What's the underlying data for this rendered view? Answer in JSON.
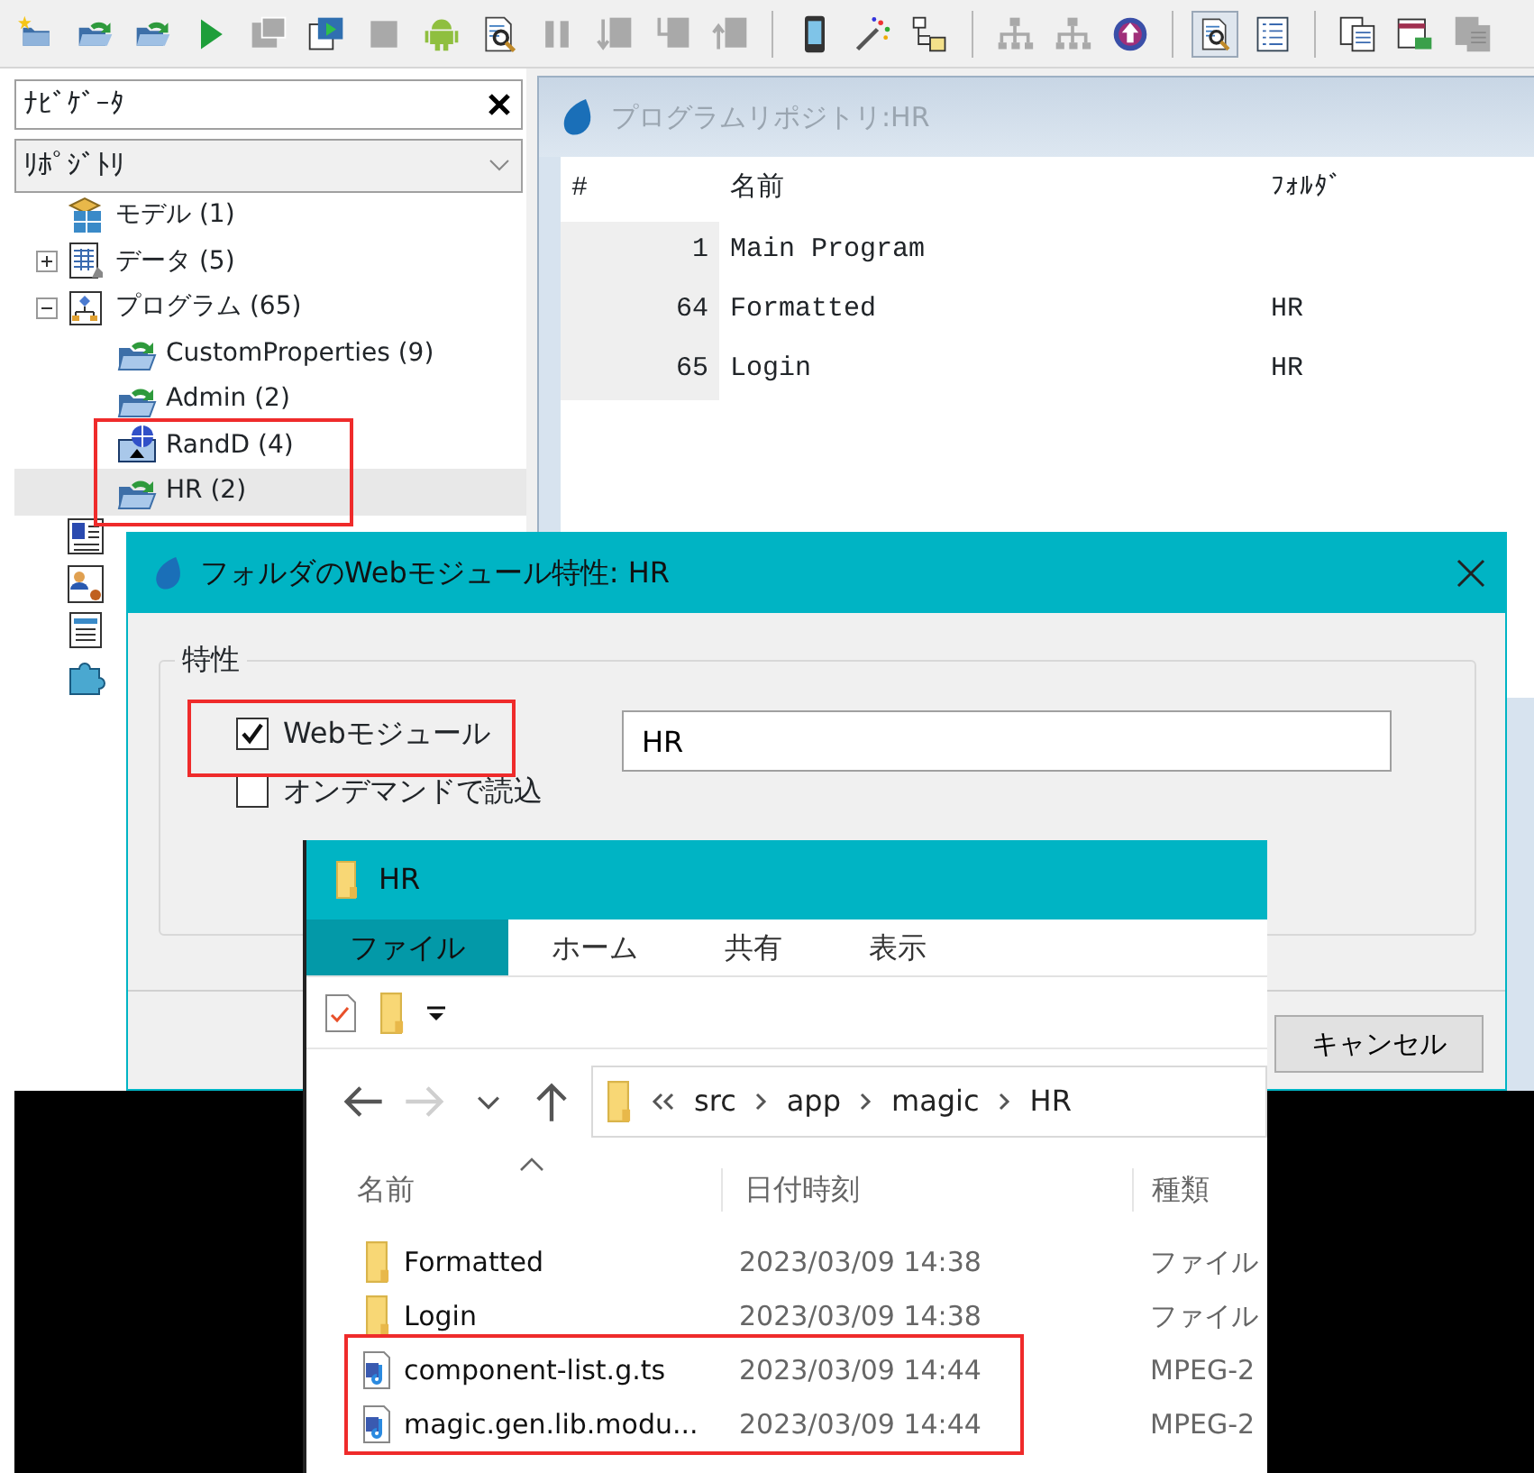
{
  "toolbar": [
    {
      "kind": "new-folder",
      "disabled": false,
      "pressed": false
    },
    {
      "kind": "open-folder",
      "disabled": false,
      "pressed": false
    },
    {
      "kind": "open-folder",
      "disabled": false,
      "pressed": false
    },
    {
      "kind": "play",
      "disabled": false,
      "pressed": false
    },
    {
      "kind": "windows",
      "disabled": true,
      "pressed": false
    },
    {
      "kind": "window-play",
      "disabled": false,
      "pressed": false
    },
    {
      "kind": "square",
      "disabled": true,
      "pressed": false
    },
    {
      "kind": "android",
      "disabled": false,
      "pressed": false
    },
    {
      "kind": "doc-search",
      "disabled": false,
      "pressed": false
    },
    {
      "kind": "pause",
      "disabled": true,
      "pressed": false
    },
    {
      "kind": "doc-down",
      "disabled": true,
      "pressed": false
    },
    {
      "kind": "doc-branch",
      "disabled": true,
      "pressed": false
    },
    {
      "kind": "doc-up",
      "disabled": true,
      "pressed": false
    },
    {
      "kind": "separator"
    },
    {
      "kind": "phone",
      "disabled": false,
      "pressed": false
    },
    {
      "kind": "wand",
      "disabled": false,
      "pressed": false
    },
    {
      "kind": "hierarchy",
      "disabled": false,
      "pressed": false
    },
    {
      "kind": "separator"
    },
    {
      "kind": "network",
      "disabled": true,
      "pressed": false
    },
    {
      "kind": "network",
      "disabled": true,
      "pressed": false
    },
    {
      "kind": "upload",
      "disabled": false,
      "pressed": false
    },
    {
      "kind": "separator"
    },
    {
      "kind": "doc-search",
      "disabled": false,
      "pressed": true
    },
    {
      "kind": "list",
      "disabled": false,
      "pressed": false
    },
    {
      "kind": "separator"
    },
    {
      "kind": "pages",
      "disabled": false,
      "pressed": false
    },
    {
      "kind": "form",
      "disabled": false,
      "pressed": false
    },
    {
      "kind": "pages",
      "disabled": true,
      "pressed": false
    }
  ],
  "navigator": {
    "title": "ﾅﾋﾞｹﾞｰﾀ",
    "view": "ﾘﾎﾟｼﾞﾄﾘ"
  },
  "tree": [
    {
      "kind": "model",
      "label": "モデル (1)",
      "selected": false
    },
    {
      "kind": "data",
      "label": "データ (5)",
      "selected": false,
      "expanded": false
    },
    {
      "kind": "program",
      "label": "プログラム (65)",
      "selected": false,
      "expanded": true,
      "children": [
        {
          "kind": "folder",
          "label": "CustomProperties (9)",
          "selected": false
        },
        {
          "kind": "folder",
          "label": "Admin (2)",
          "selected": false
        },
        {
          "kind": "web-folder",
          "label": "RandD (4)",
          "selected": false
        },
        {
          "kind": "folder",
          "label": "HR (2)",
          "selected": true
        }
      ]
    },
    {
      "kind": "help",
      "selected": false
    },
    {
      "kind": "card",
      "selected": false
    },
    {
      "kind": "doc",
      "selected": false
    },
    {
      "kind": "puzzle",
      "selected": false
    }
  ],
  "repository_window": {
    "title": "プログラムリポジトリ:HR",
    "columns": [
      "#",
      "名前",
      "ﾌｫﾙﾀﾞ"
    ],
    "rows": [
      {
        "number": "1",
        "name": "Main Program"
      },
      {
        "number": "64",
        "name": "Formatted",
        "folder": "HR"
      },
      {
        "number": "65",
        "name": "Login",
        "folder": "HR"
      }
    ]
  },
  "dialog": {
    "title": "フォルダのWebモジュール特性: HR",
    "group": "特性",
    "options": [
      {
        "label": "Webモジュール",
        "checked": true
      },
      {
        "label": "オンデマンドで読込",
        "checked": false
      }
    ],
    "module_name": "HR",
    "buttons": [
      "キャンセル"
    ]
  },
  "explorer": {
    "title": "HR",
    "tabs": [
      {
        "label": "ファイル",
        "selected": true
      },
      {
        "label": "ホーム",
        "selected": false
      },
      {
        "label": "共有",
        "selected": false
      },
      {
        "label": "表示",
        "selected": false
      }
    ],
    "nav_buttons": [
      {
        "kind": "back",
        "disabled": false
      },
      {
        "kind": "forward",
        "disabled": true
      },
      {
        "kind": "recent",
        "disabled": false
      },
      {
        "kind": "up",
        "disabled": false
      }
    ],
    "path": [
      "src",
      "app",
      "magic",
      "HR"
    ],
    "columns": [
      "名前",
      "日付時刻",
      "種類"
    ],
    "files": [
      {
        "kind": "folder",
        "name": "Formatted",
        "modified": "2023/03/09 14:38",
        "type": "ファイル"
      },
      {
        "kind": "folder",
        "name": "Login",
        "modified": "2023/03/09 14:38",
        "type": "ファイル"
      },
      {
        "kind": "file",
        "name": "component-list.g.ts",
        "modified": "2023/03/09 14:44",
        "type": "MPEG-2"
      },
      {
        "kind": "file",
        "name": "magic.gen.lib.modu...",
        "modified": "2023/03/09 14:44",
        "type": "MPEG-2"
      }
    ]
  }
}
